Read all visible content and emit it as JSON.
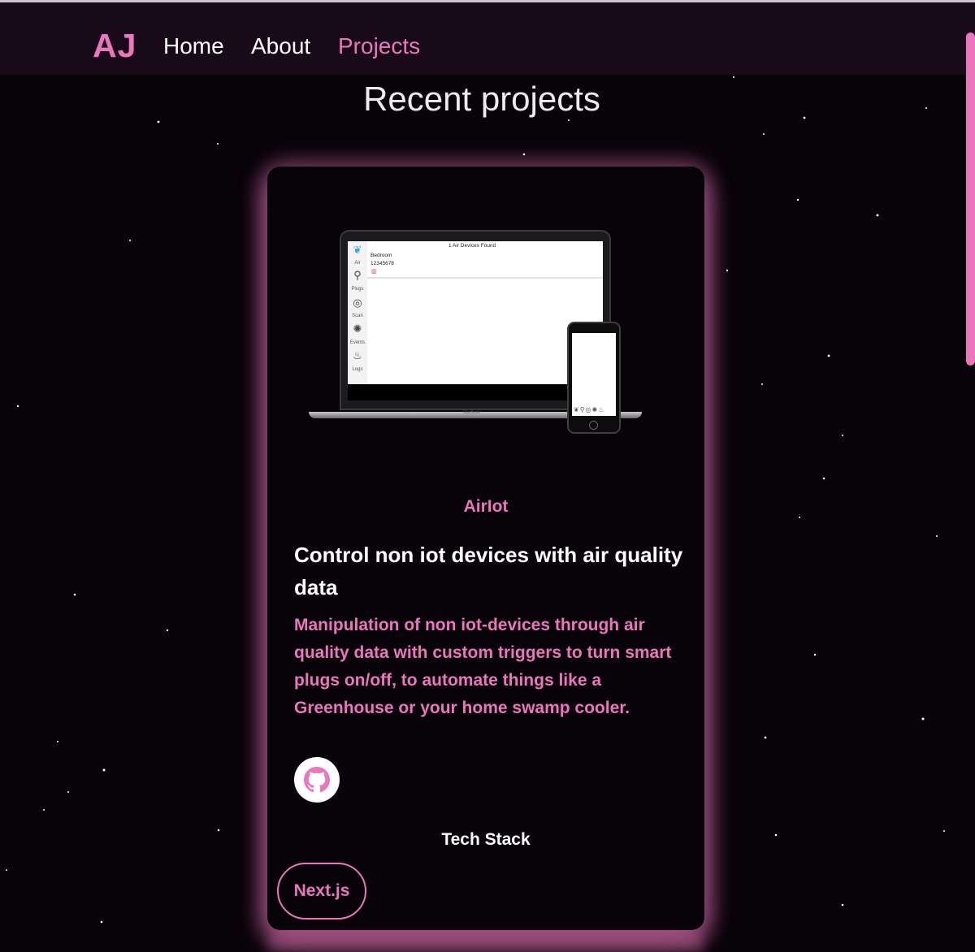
{
  "nav": {
    "logo": "AJ",
    "links": [
      "Home",
      "About",
      "Projects"
    ],
    "active_link": "Projects"
  },
  "main": {
    "title": "Recent projects"
  },
  "project": {
    "name": "AirIot",
    "heading": "Control non iot devices with air quality data",
    "description": "Manipulation of non iot-devices through air quality data with custom triggers to turn smart plugs on/off, to automate things like a Greenhouse or your home swamp cooler.",
    "tech_title": "Tech Stack",
    "tech_stack": [
      "Next.js"
    ],
    "preview": {
      "found_text": "1 Air Devices Found",
      "room": "Bedroom",
      "device_id": "12345678",
      "sidebar_labels": [
        "Air",
        "Plugs",
        "Scan",
        "Events",
        "Logs"
      ],
      "laptop_brand": "MacBook"
    }
  },
  "colors": {
    "accent": "#ea76bc",
    "background": "#080309",
    "navbar": "#180a18"
  },
  "icons": {
    "github": "github-icon"
  }
}
